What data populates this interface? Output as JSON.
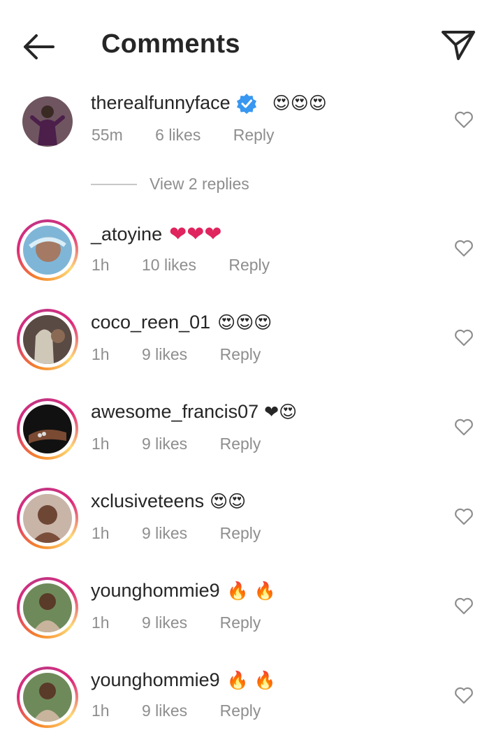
{
  "header": {
    "title": "Comments",
    "back_icon": "arrow-left-icon",
    "share_icon": "paper-plane-icon"
  },
  "comments": [
    {
      "username": "therealfunnyface",
      "verified": true,
      "emojis": "😍😍😍",
      "time": "55m",
      "likes": "6 likes",
      "reply": "Reply",
      "story_ring": false
    },
    {
      "username": "_atoyine",
      "emojis": "❤❤❤",
      "time": "1h",
      "likes": "10 likes",
      "reply": "Reply",
      "story_ring": true
    },
    {
      "username": "coco_reen_01",
      "emojis": "😍😍😍",
      "time": "1h",
      "likes": "9 likes",
      "reply": "Reply",
      "story_ring": true
    },
    {
      "username": "awesome_francis07",
      "emojis": "❤😍",
      "time": "1h",
      "likes": "9 likes",
      "reply": "Reply",
      "story_ring": true
    },
    {
      "username": "xclusiveteens",
      "emojis": "😍😍",
      "time": "1h",
      "likes": "9 likes",
      "reply": "Reply",
      "story_ring": true
    },
    {
      "username": "younghommie9",
      "emojis": "🔥 🔥",
      "time": "1h",
      "likes": "9 likes",
      "reply": "Reply",
      "story_ring": true
    },
    {
      "username": "younghommie9",
      "emojis": "🔥 🔥",
      "time": "1h",
      "likes": "9 likes",
      "reply": "Reply",
      "story_ring": true
    }
  ],
  "view_replies": "View 2 replies",
  "colors": {
    "text": "#262626",
    "muted": "#8e8e8e",
    "verified": "#3897f0",
    "heart": "#e0245e"
  }
}
